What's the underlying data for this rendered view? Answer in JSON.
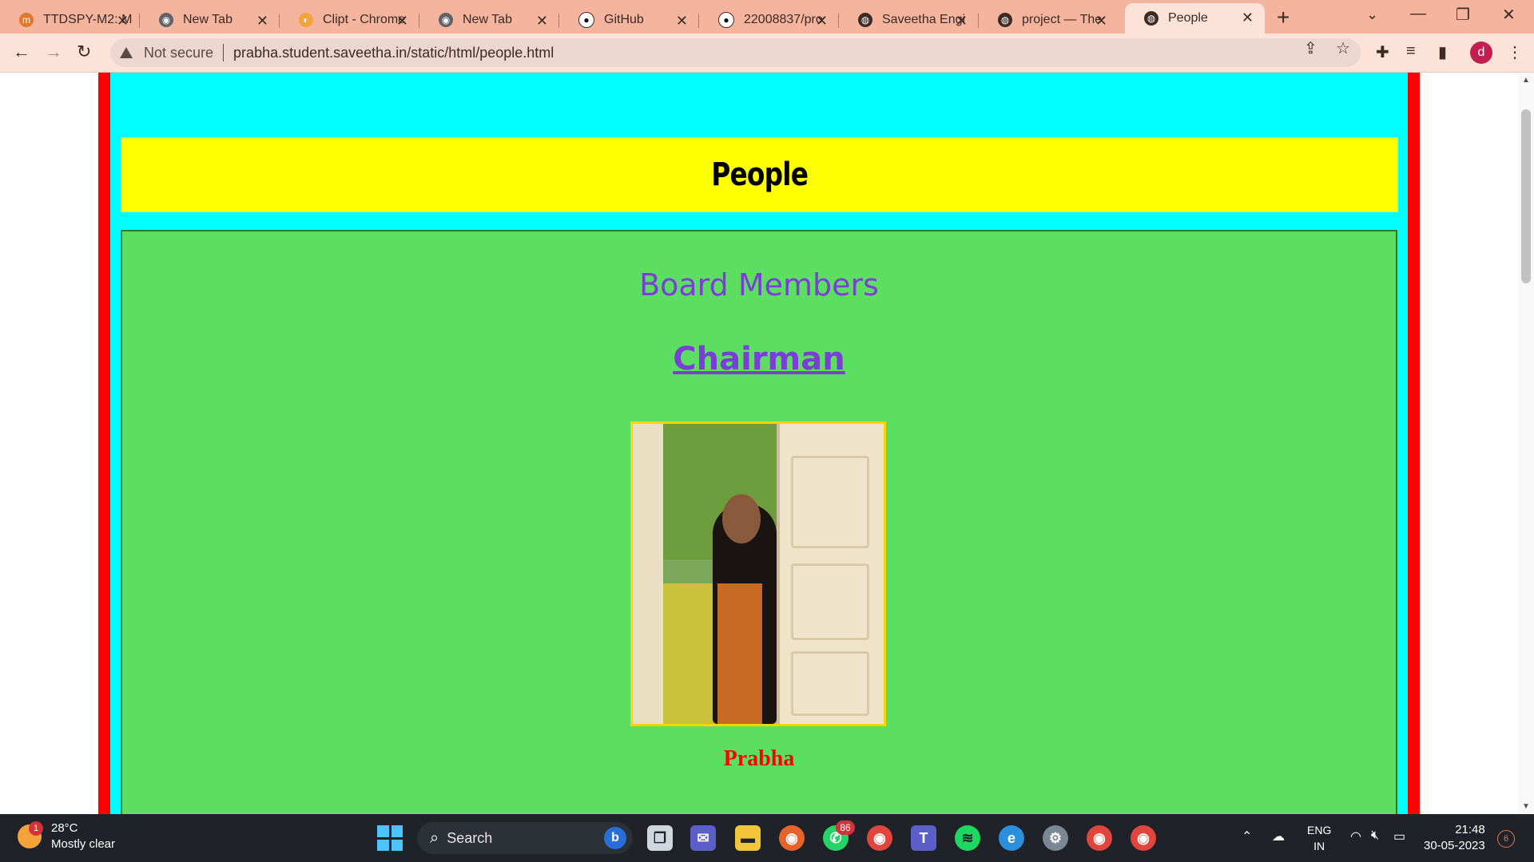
{
  "browser": {
    "tabs": [
      {
        "label": "TTDSPY-M2: M",
        "icon": "moodle-icon",
        "active": false
      },
      {
        "label": "New Tab",
        "icon": "chrome-icon",
        "active": false
      },
      {
        "label": "Clipt - Chrome",
        "icon": "clipt-icon",
        "active": false
      },
      {
        "label": "New Tab",
        "icon": "chrome-icon",
        "active": false
      },
      {
        "label": "GitHub",
        "icon": "github-icon",
        "active": false
      },
      {
        "label": "22008837/pro",
        "icon": "github-icon",
        "active": false
      },
      {
        "label": "Saveetha Engi",
        "icon": "globe-icon",
        "active": false
      },
      {
        "label": "project — The",
        "icon": "globe-icon",
        "active": false
      },
      {
        "label": "People",
        "icon": "globe-icon",
        "active": true
      }
    ],
    "security_label": "Not secure",
    "url": "prabha.student.saveetha.in/static/html/people.html",
    "profile_initial": "d"
  },
  "page": {
    "heading": "People",
    "section_title": "Board Members",
    "role_link": "Chairman",
    "member_name": "Prabha"
  },
  "taskbar": {
    "weather_temp": "28°C",
    "weather_desc": "Mostly clear",
    "weather_badge": "1",
    "search_placeholder": "Search",
    "whatsapp_badge": "86",
    "language": "ENG",
    "region": "IN",
    "time": "21:48",
    "date": "30-05-2023",
    "notification_count": "6"
  },
  "colors": {
    "page_frame": "#ff0000",
    "page_bg": "#00ffff",
    "header_bg": "#ffff00",
    "content_bg": "#5cdf60",
    "purple_text": "#7a3fd6",
    "name_text": "#ff0000"
  }
}
